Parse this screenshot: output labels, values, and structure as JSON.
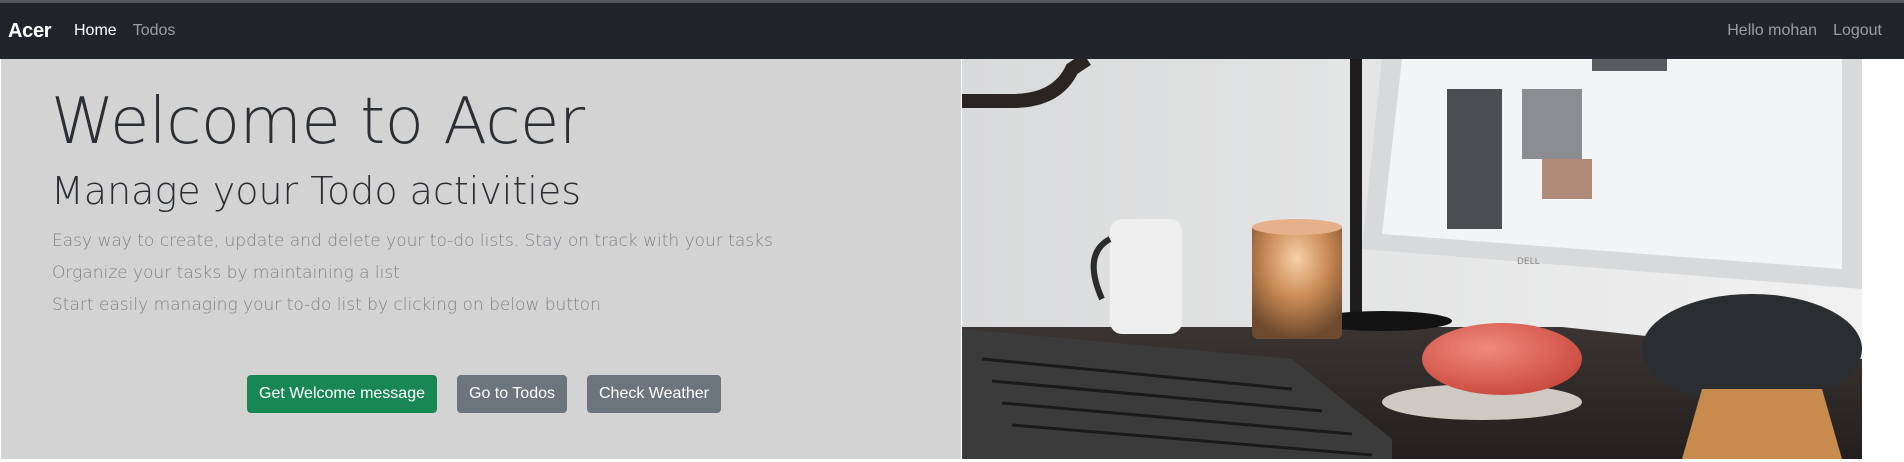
{
  "navbar": {
    "brand": "Acer",
    "links": [
      {
        "label": "Home",
        "active": true
      },
      {
        "label": "Todos",
        "active": false
      }
    ],
    "greeting": "Hello mohan",
    "logout": "Logout"
  },
  "hero": {
    "title": "Welcome to Acer",
    "subtitle": "Manage your Todo activities",
    "lines": [
      "Easy way to create, update and delete your to-do lists. Stay on track with your tasks",
      "Organize your tasks by maintaining a list",
      "Start easily managing your to-do list by clicking on below button"
    ],
    "buttons": {
      "welcome": "Get Welcome message",
      "todos": "Go to Todos",
      "weather": "Check Weather"
    }
  },
  "colors": {
    "navbar_bg": "#212529",
    "hero_bg": "#d3d3d3",
    "success": "#198754",
    "secondary": "#6c757d"
  }
}
